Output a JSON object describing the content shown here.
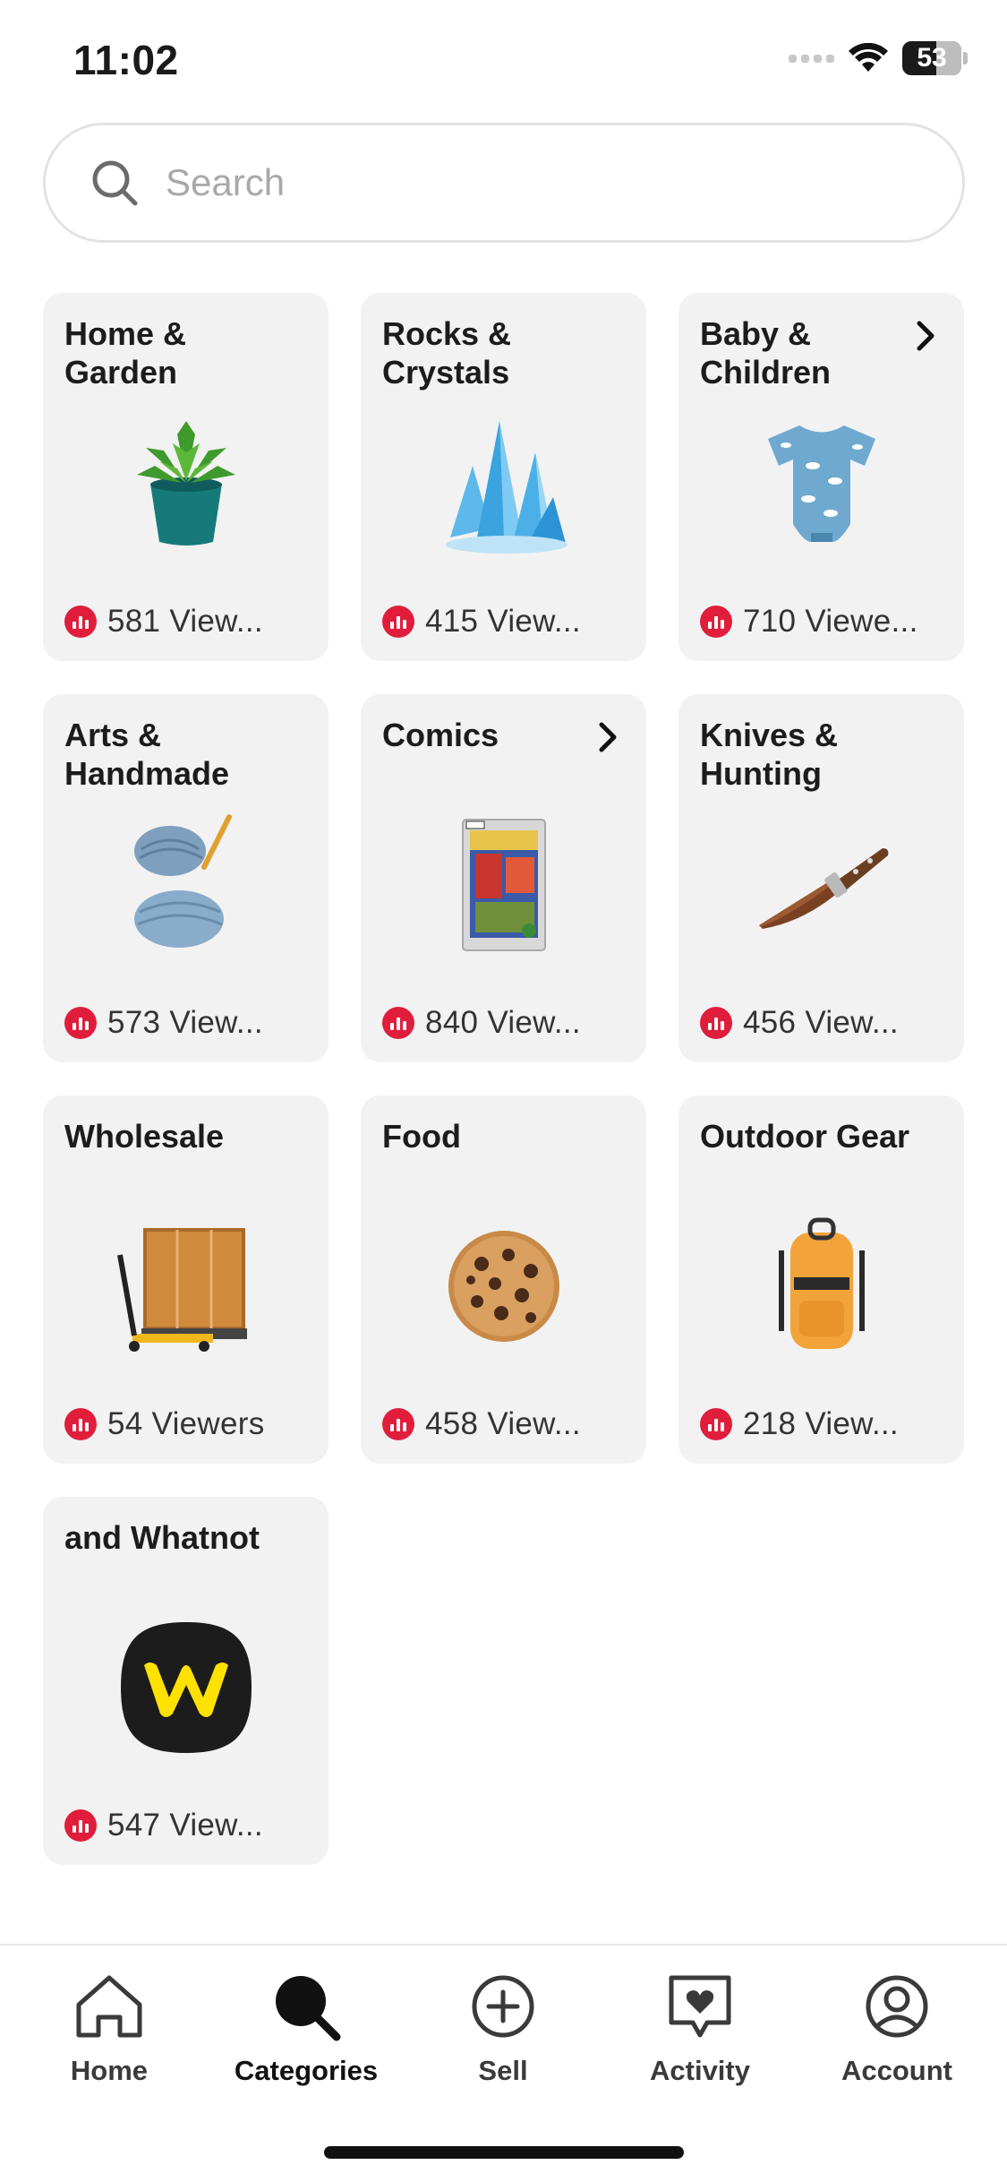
{
  "status_bar": {
    "time": "11:02",
    "battery": "53"
  },
  "search": {
    "placeholder": "Search"
  },
  "categories": [
    {
      "title": "Home & Garden",
      "viewers": "581 View...",
      "icon": "succulent-plant-image",
      "has_chevron": false
    },
    {
      "title": "Rocks & Crystals",
      "viewers": "415 View...",
      "icon": "blue-crystal-image",
      "has_chevron": false
    },
    {
      "title": "Baby & Children",
      "viewers": "710 Viewe...",
      "icon": "baby-onesie-image",
      "has_chevron": true
    },
    {
      "title": "Arts & Handmade",
      "viewers": "573 View...",
      "icon": "yarn-crochet-image",
      "has_chevron": false
    },
    {
      "title": "Comics",
      "viewers": "840 View...",
      "icon": "spiderman-comic-image",
      "has_chevron": true
    },
    {
      "title": "Knives & Hunting",
      "viewers": "456 View...",
      "icon": "hunting-knife-image",
      "has_chevron": false
    },
    {
      "title": "Wholesale",
      "viewers": "54 Viewers",
      "icon": "pallet-jack-crate-image",
      "has_chevron": false
    },
    {
      "title": "Food",
      "viewers": "458 View...",
      "icon": "cookie-image",
      "has_chevron": false
    },
    {
      "title": "Outdoor Gear",
      "viewers": "218 View...",
      "icon": "backpack-image",
      "has_chevron": false
    },
    {
      "title": "and Whatnot",
      "viewers": "547 View...",
      "icon": "whatnot-logo-image",
      "has_chevron": false
    }
  ],
  "tabbar": {
    "tabs": [
      {
        "label": "Home",
        "icon": "house-icon",
        "active": false
      },
      {
        "label": "Categories",
        "icon": "search-filled-icon",
        "active": true
      },
      {
        "label": "Sell",
        "icon": "plus-circle-icon",
        "active": false
      },
      {
        "label": "Activity",
        "icon": "heart-message-icon",
        "active": false
      },
      {
        "label": "Account",
        "icon": "user-circle-icon",
        "active": false
      }
    ]
  },
  "colors": {
    "live_red": "#e01e3c",
    "card_bg": "#f2f2f2",
    "whatnot_yellow": "#ffe100"
  }
}
